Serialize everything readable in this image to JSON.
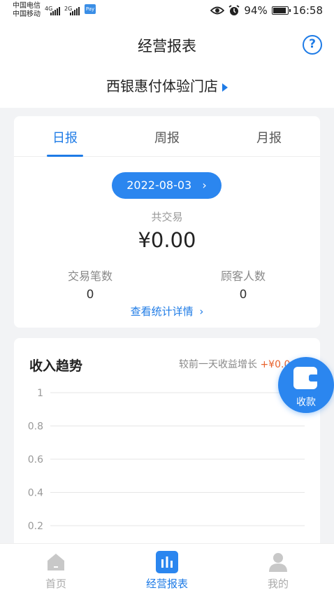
{
  "status_bar": {
    "carrier1": "中国电信",
    "carrier2": "中国移动",
    "sig1_label": "4G",
    "sig2_label": "2G",
    "pay_label": "Pay",
    "battery_percent": "94%",
    "battery_level": 0.94,
    "time": "16:58"
  },
  "header": {
    "title": "经营报表",
    "help_label": "?",
    "store_name": "西银惠付体验门店"
  },
  "tabs": [
    {
      "label": "日报",
      "active": true
    },
    {
      "label": "周报",
      "active": false
    },
    {
      "label": "月报",
      "active": false
    }
  ],
  "daily": {
    "date": "2022-08-03",
    "date_chevron": "›",
    "total_label": "共交易",
    "total_value": "¥0.00",
    "tx_count_label": "交易笔数",
    "tx_count": "0",
    "customers_label": "顾客人数",
    "customers": "0",
    "detail_link": "查看统计详情",
    "detail_chevron": "›"
  },
  "trend": {
    "title": "收入趋势",
    "compare_label": "较前一天收益增长",
    "compare_value": "+¥0.0"
  },
  "chart_data": {
    "type": "line",
    "title": "收入趋势",
    "y_ticks": [
      "1",
      "0.8",
      "0.6",
      "0.4",
      "0.2"
    ],
    "ylim": [
      0,
      1
    ],
    "grid": true,
    "series": []
  },
  "fab": {
    "label": "收款"
  },
  "bottom_nav": [
    {
      "label": "首页",
      "icon": "home-icon",
      "active": false
    },
    {
      "label": "经营报表",
      "icon": "bar-chart-icon",
      "active": true
    },
    {
      "label": "我的",
      "icon": "user-icon",
      "active": false
    }
  ],
  "colors": {
    "accent": "#1e7be6",
    "accent_pill": "#2b86ef",
    "increase": "#e8622c",
    "background": "#f2f3f5"
  }
}
